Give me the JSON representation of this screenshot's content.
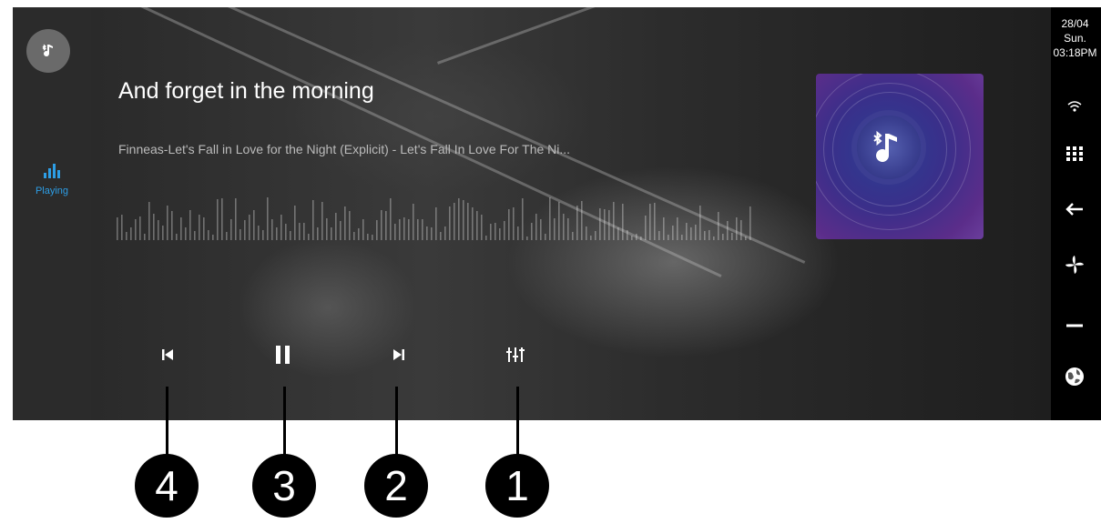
{
  "left_sidebar": {
    "source_icon": "bluetooth-music-icon",
    "playing_label": "Playing",
    "playing_icon": "equalizer-bars-icon"
  },
  "track": {
    "title": "And forget in the morning",
    "subtitle": "Finneas-Let's Fall in Love for the Night (Explicit) - Let's Fall In Love For The Ni..."
  },
  "album_art": {
    "icon": "bluetooth-music-note-icon"
  },
  "controls": {
    "previous": "skip-previous-icon",
    "pause": "pause-icon",
    "next": "skip-next-icon",
    "equalizer": "equalizer-sliders-icon"
  },
  "callouts": [
    "4",
    "3",
    "2",
    "1"
  ],
  "status_bar": {
    "date": "28/04",
    "day": "Sun.",
    "time": "03:18PM",
    "icons": [
      "wifi-icon",
      "apps-grid-icon",
      "back-arrow-icon",
      "fan-icon",
      "minus-icon",
      "globe-icon"
    ]
  },
  "colors": {
    "accent": "#2d9ee6",
    "album_purple": "#4b2f8c"
  }
}
